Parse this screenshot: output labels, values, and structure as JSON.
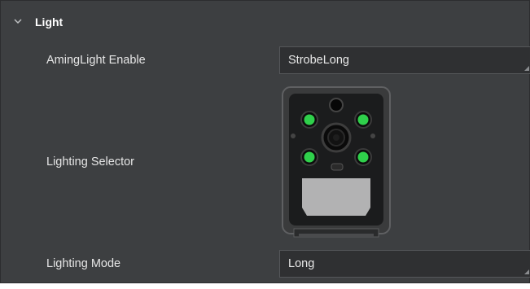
{
  "section": {
    "title": "Light",
    "icon": "chevron-down-icon"
  },
  "rows": [
    {
      "label": "AmingLight Enable",
      "value": "StrobeLong"
    },
    {
      "label": "Lighting Selector"
    },
    {
      "label": "Lighting Mode",
      "value": "Long"
    }
  ],
  "device_image": {
    "led_color": "#2fd04b"
  }
}
